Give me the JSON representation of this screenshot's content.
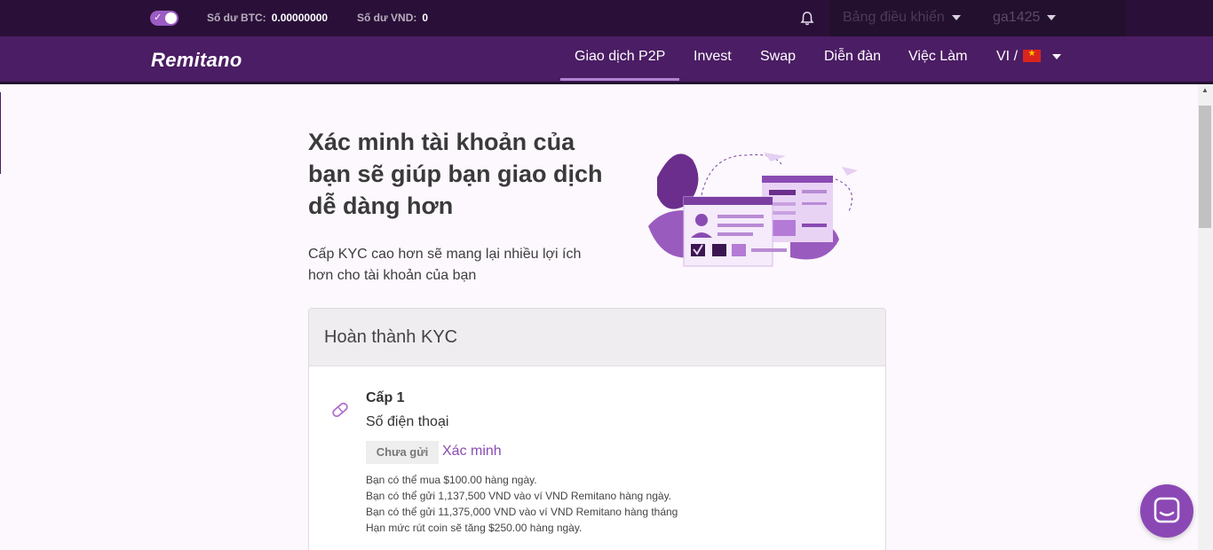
{
  "topbar": {
    "btc_label": "Số dư BTC:",
    "btc_value": "0.00000000",
    "vnd_label": "Số dư VND:",
    "vnd_value": "0",
    "dashboard_label": "Bảng điều khiển",
    "username": "ga1425"
  },
  "nav": {
    "logo": "Remitano",
    "items": [
      "Giao dịch P2P",
      "Invest",
      "Swap",
      "Diễn đàn",
      "Việc Làm"
    ],
    "language": "VI /"
  },
  "hero": {
    "title": "Xác minh tài khoản của bạn sẽ giúp bạn giao dịch dễ dàng hơn",
    "subtitle": "Cấp KYC cao hơn sẽ mang lại nhiều lợi ích hơn cho tài khoản của bạn"
  },
  "kyc": {
    "header": "Hoàn thành KYC",
    "level_label": "Cấp 1",
    "method": "Số điện thoại",
    "status": "Chưa gửi",
    "verify_link": "Xác minh",
    "limits": [
      "Bạn có thể mua $100.00 hàng ngày.",
      "Bạn có thể gửi 1,137,500 VND vào ví VND Remitano hàng ngày.",
      "Bạn có thể gửi 11,375,000 VND vào ví VND Remitano hàng tháng",
      "Hạn mức rút coin sẽ tăng $250.00 hàng ngày."
    ]
  },
  "colors": {
    "brand": "#4b1d64",
    "accent": "#8a4bb2"
  }
}
